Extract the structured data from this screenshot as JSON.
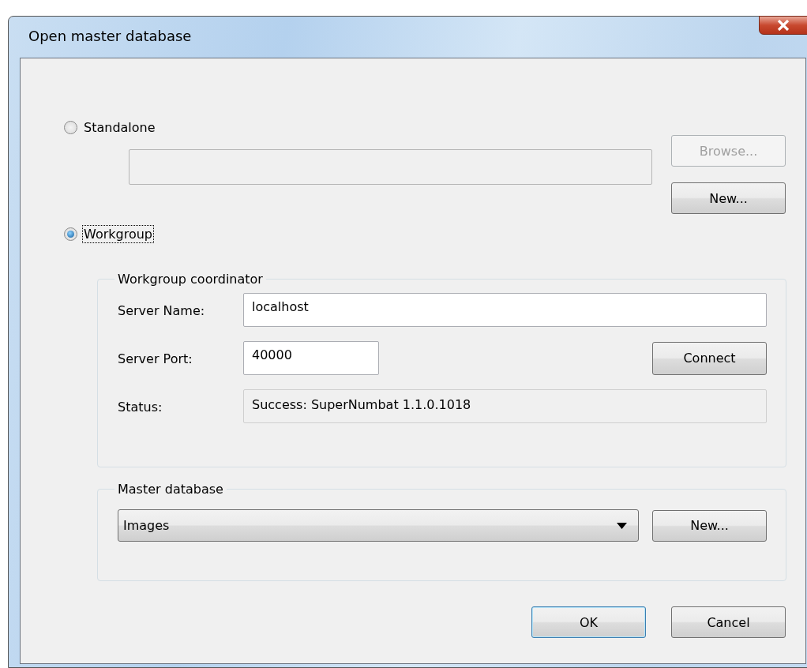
{
  "window": {
    "title": "Open master database"
  },
  "modes": [
    {
      "label": "Standalone",
      "selected": false,
      "focused": false
    },
    {
      "label": "Workgroup",
      "selected": true,
      "focused": true
    }
  ],
  "standalone": {
    "path_field": {
      "disabled": true
    },
    "buttons": [
      {
        "label": "Browse...",
        "disabled": true
      },
      {
        "label": "New...",
        "disabled": false
      }
    ]
  },
  "coordinator": {
    "title": "Workgroup coordinator",
    "server_name": {
      "label": "Server Name:",
      "value": "localhost"
    },
    "server_port": {
      "label": "Server Port:",
      "value": "40000"
    },
    "connect_button": "Connect",
    "status": {
      "label": "Status:",
      "value": "Success: SuperNumbat 1.1.0.1018"
    }
  },
  "master": {
    "title": "Master database",
    "dropdown": {
      "value": "Images"
    },
    "new_button": "New..."
  },
  "buttons": [
    {
      "label": "OK",
      "default": true
    },
    {
      "label": "Cancel",
      "default": false
    }
  ]
}
